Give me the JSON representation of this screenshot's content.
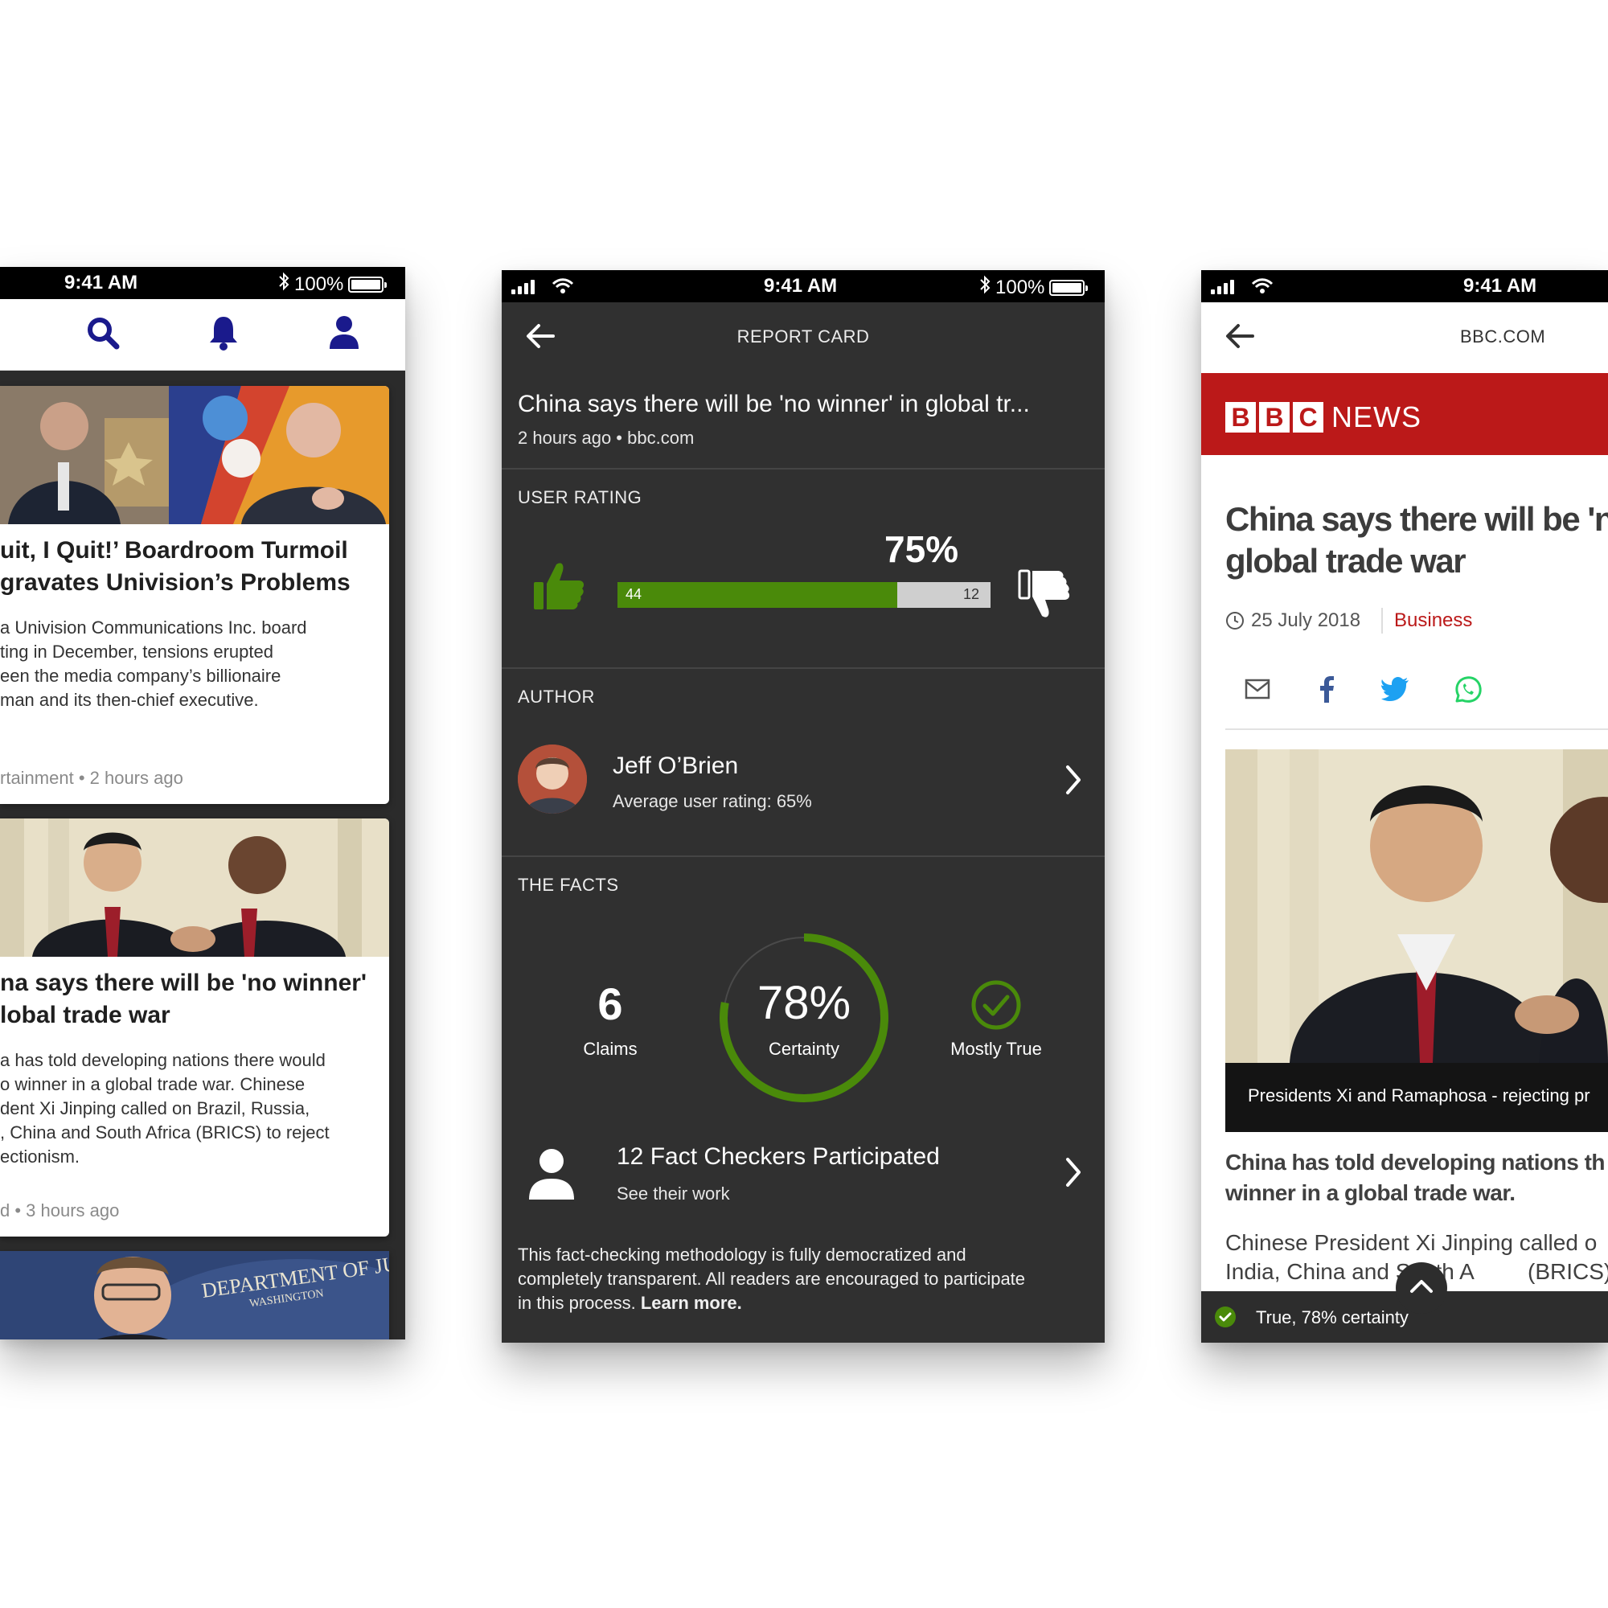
{
  "status": {
    "time": "9:41 AM",
    "battery": "100%"
  },
  "feed": {
    "nav_icons": [
      "search-icon",
      "bell-icon",
      "user-icon"
    ],
    "cards": [
      {
        "title_lines": [
          "uit, I Quit!’ Boardroom Turmoil",
          "gravates Univision’s Problems"
        ],
        "body_lines": [
          " a Univision Communications Inc. board",
          "ting in December, tensions erupted",
          "een the media company’s billionaire",
          "man and its then-chief executive."
        ],
        "meta": "rtainment • 2 hours ago"
      },
      {
        "title_lines": [
          "na says there will be 'no winner'",
          "lobal trade war"
        ],
        "body_lines": [
          "a has told developing nations there would",
          "o winner in a global trade war. Chinese",
          "dent Xi Jinping called on Brazil, Russia,",
          ", China and South Africa (BRICS) to reject",
          "ectionism."
        ],
        "meta": "d • 3 hours ago"
      }
    ],
    "third_card_sign": "DEPARTMENT OF JU",
    "third_card_sign2": "WASHINGTON"
  },
  "report": {
    "header_title": "REPORT CARD",
    "article_title": "China says there will be 'no winner' in global tr...",
    "article_meta": "2 hours ago • bbc.com",
    "user_rating_label": "USER RATING",
    "rating_percent": "75%",
    "rating_fraction": 0.75,
    "upvotes": "44",
    "downvotes": "12",
    "author_label": "AUTHOR",
    "author_name": "Jeff O’Brien",
    "author_rating": "Average user rating: 65%",
    "facts_label": "THE FACTS",
    "claims_count": "6",
    "claims_label": "Claims",
    "certainty_percent": "78%",
    "certainty_fraction": 0.78,
    "certainty_label": "Certainty",
    "verdict_label": "Mostly True",
    "checkers_title": "12 Fact Checkers Participated",
    "checkers_sub": "See their work",
    "methodology_lines": [
      "This fact-checking methodology is fully democratized and",
      "completely transparent. All readers are encouraged to participate",
      "in this process. "
    ],
    "learn_more": "Learn more.",
    "colors": {
      "accent": "#4a8a0a",
      "background": "#303030"
    }
  },
  "article": {
    "site": "BBC.COM",
    "logo_letters": [
      "B",
      "B",
      "C"
    ],
    "logo_word": "NEWS",
    "headline_lines": [
      "China says there will be 'no",
      "global trade war"
    ],
    "date": "25 July 2018",
    "category": "Business",
    "share_icons": [
      "mail-icon",
      "facebook-icon",
      "twitter-icon",
      "whatsapp-icon"
    ],
    "caption": "Presidents Xi and Ramaphosa - rejecting pr",
    "intro_lines": [
      "China has told developing nations th",
      "winner in a global trade war."
    ],
    "body_lines": [
      "Chinese President Xi Jinping called o",
      "India, China and South A",
      "(BRICS)"
    ],
    "bottom_status": "True, 78% certainty",
    "colors": {
      "brand": "#bb1919",
      "link": "#bb1919"
    }
  }
}
